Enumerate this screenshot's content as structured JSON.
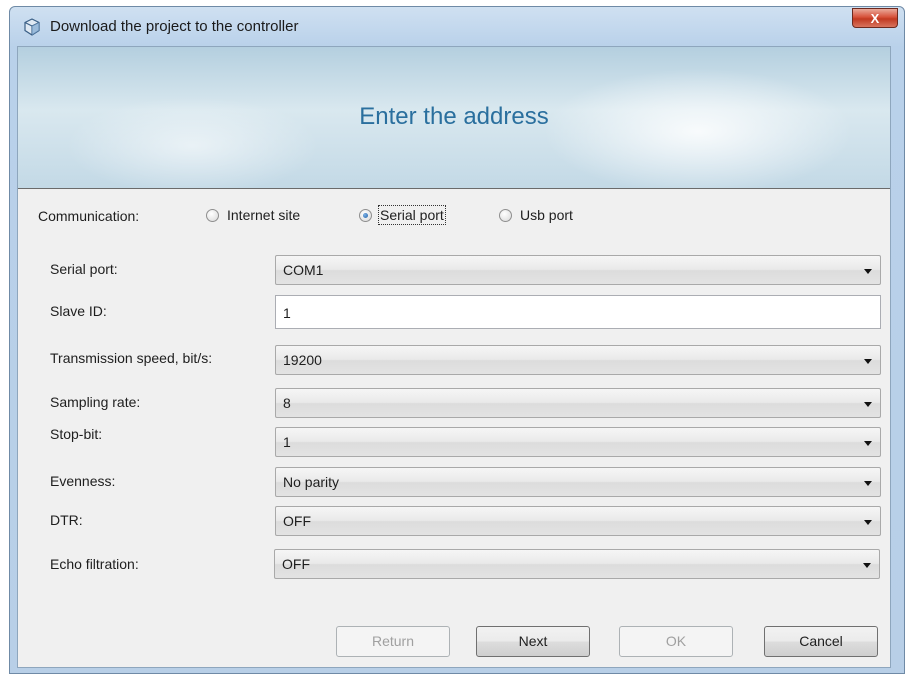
{
  "window": {
    "title": "Download the project to the controller",
    "close_label": "X"
  },
  "banner": {
    "title": "Enter the address"
  },
  "communication": {
    "label": "Communication:",
    "options": [
      {
        "label": "Internet site",
        "selected": false
      },
      {
        "label": "Serial port",
        "selected": true
      },
      {
        "label": "Usb port",
        "selected": false
      }
    ]
  },
  "fields": [
    {
      "label": "Serial port:",
      "value": "COM1",
      "kind": "dropdown"
    },
    {
      "label": "Slave ID:",
      "value": "1",
      "kind": "text"
    },
    {
      "label": "Transmission speed, bit/s:",
      "value": "19200",
      "kind": "dropdown"
    },
    {
      "label": "Sampling rate:",
      "value": "8",
      "kind": "dropdown"
    },
    {
      "label": "Stop-bit:",
      "value": "1",
      "kind": "dropdown"
    },
    {
      "label": "Evenness:",
      "value": "No parity",
      "kind": "dropdown"
    },
    {
      "label": "DTR:",
      "value": "OFF",
      "kind": "dropdown"
    },
    {
      "label": "Echo filtration:",
      "value": "OFF",
      "kind": "dropdown"
    }
  ],
  "buttons": {
    "return": {
      "label": "Return",
      "enabled": false
    },
    "next": {
      "label": "Next",
      "enabled": true
    },
    "ok": {
      "label": "OK",
      "enabled": false
    },
    "cancel": {
      "label": "Cancel",
      "enabled": true
    }
  }
}
